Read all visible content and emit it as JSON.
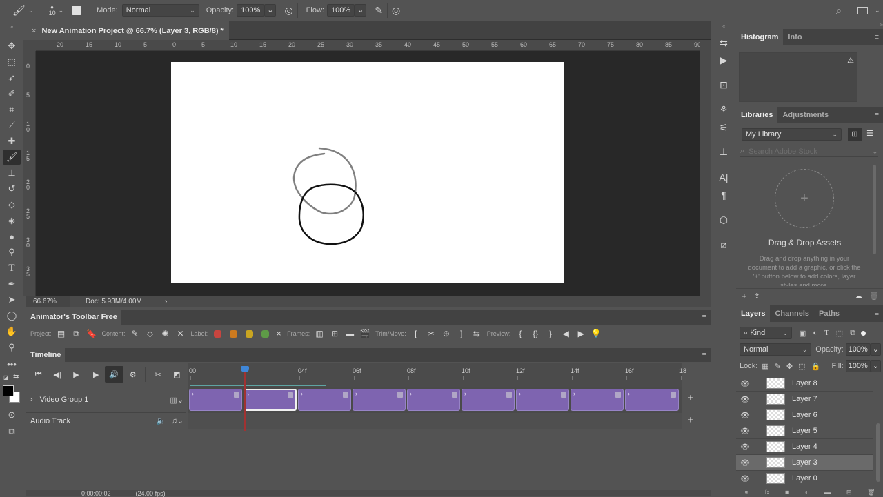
{
  "options_bar": {
    "brush_size": "10",
    "mode_label": "Mode:",
    "mode_value": "Normal",
    "opacity_label": "Opacity:",
    "opacity_value": "100%",
    "flow_label": "Flow:",
    "flow_value": "100%"
  },
  "document": {
    "tab_title": "New Animation Project @ 66.7% (Layer 3, RGB/8) *",
    "close_glyph": "×"
  },
  "rulers": {
    "horizontal": [
      "20",
      "15",
      "10",
      "5",
      "0",
      "5",
      "10",
      "15",
      "20",
      "25",
      "30",
      "35",
      "40",
      "45",
      "50",
      "55",
      "60",
      "65",
      "70",
      "75",
      "80",
      "85",
      "90"
    ],
    "vertical": [
      "0",
      "5",
      "10",
      "15",
      "20",
      "25",
      "30",
      "35"
    ]
  },
  "status": {
    "zoom": "66.67%",
    "doc_size": "Doc: 5.93M/4.00M",
    "arrow": "›"
  },
  "animator_toolbar": {
    "title": "Animator's Toolbar Free",
    "project_label": "Project:",
    "content_label": "Content:",
    "label_label": "Label:",
    "frames_label": "Frames:",
    "trim_label": "Trim/Move:",
    "preview_label": "Preview:",
    "label_colors": [
      "#c8453f",
      "#cc7a1f",
      "#c9a521",
      "#5e9a47"
    ],
    "clear_label": "×"
  },
  "timeline": {
    "title": "Timeline",
    "ruler_ticks": [
      "00",
      "02f",
      "04f",
      "06f",
      "08f",
      "10f",
      "12f",
      "14f",
      "16f",
      "18"
    ],
    "video_group": "Video Group 1",
    "audio_track": "Audio Track",
    "current_frame": 2,
    "clip_count": 9,
    "selected_clip": 2,
    "timecode": "0:00:00:02",
    "fps": "(24.00 fps)"
  },
  "right_panels": {
    "histogram_tabs": [
      "Histogram",
      "Info"
    ],
    "libraries_tabs": [
      "Libraries",
      "Adjustments"
    ],
    "library_select": "My Library",
    "search_placeholder": "Search Adobe Stock",
    "drop_title": "Drag & Drop Assets",
    "drop_text": "Drag and drop anything in your document to add a graphic, or click the '+' button below to add colors, layer styles and more."
  },
  "layers_panel": {
    "tabs": [
      "Layers",
      "Channels",
      "Paths"
    ],
    "kind_filter": "Kind",
    "blend_mode": "Normal",
    "opacity_label": "Opacity:",
    "opacity_value": "100%",
    "lock_label": "Lock:",
    "fill_label": "Fill:",
    "fill_value": "100%",
    "layers": [
      {
        "name": "Layer 8",
        "visible": true,
        "selected": false
      },
      {
        "name": "Layer 7",
        "visible": true,
        "selected": false
      },
      {
        "name": "Layer 6",
        "visible": true,
        "selected": false
      },
      {
        "name": "Layer 5",
        "visible": true,
        "selected": false
      },
      {
        "name": "Layer 4",
        "visible": true,
        "selected": false
      },
      {
        "name": "Layer 3",
        "visible": true,
        "selected": true
      },
      {
        "name": "Layer 0",
        "visible": true,
        "selected": false
      }
    ]
  }
}
